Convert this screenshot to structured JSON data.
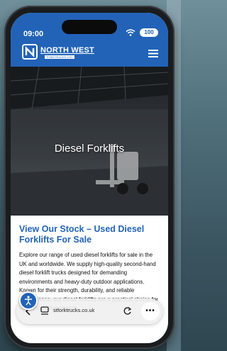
{
  "status_bar": {
    "time": "09:00",
    "battery": "100"
  },
  "header": {
    "logo_title": "NORTH WEST",
    "logo_subtitle": "FORKTRUCKS LTD"
  },
  "hero": {
    "title": "Diesel Forklifts"
  },
  "content": {
    "heading": "View Our Stock – Used Diesel Forklifts For Sale",
    "body": "Explore our range of used diesel forklifts for sale in the UK and worldwide. We supply high-quality second-hand diesel forklift trucks designed for demanding environments and heavy-duty outdoor applications. Known for their strength, durability, and reliable performance, our diesel forklifts are a practical choice for businesses that require"
  },
  "browser_bar": {
    "url": "stforktrucks.co.uk",
    "more_label": "•••"
  },
  "colors": {
    "brand": "#2263b7",
    "hero_text": "#ffffff",
    "body_text": "#111111"
  },
  "icons": [
    "wifi-icon",
    "logo-mark-icon",
    "menu-icon",
    "accessibility-icon",
    "back-icon",
    "tabs-icon",
    "reload-icon",
    "more-icon"
  ]
}
